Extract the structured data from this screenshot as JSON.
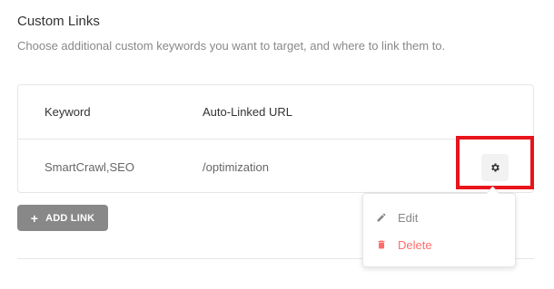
{
  "section": {
    "title": "Custom Links",
    "description": "Choose additional custom keywords you want to target, and where to link them to."
  },
  "table": {
    "columns": [
      "Keyword",
      "Auto-Linked URL"
    ],
    "rows": [
      {
        "keyword": "SmartCrawl,SEO",
        "url": "/optimization"
      }
    ]
  },
  "actions": {
    "add_link_label": "ADD LINK",
    "add_link_icon": "plus-icon",
    "row_options_icon": "gear-icon"
  },
  "dropdown": {
    "items": [
      {
        "label": "Edit",
        "icon": "pencil-icon",
        "color": "#888888"
      },
      {
        "label": "Delete",
        "icon": "trash-icon",
        "color": "#ff6d6d"
      }
    ]
  },
  "colors": {
    "highlight": "#e8141c",
    "add_button_bg": "#888888",
    "delete": "#ff6d6d"
  }
}
